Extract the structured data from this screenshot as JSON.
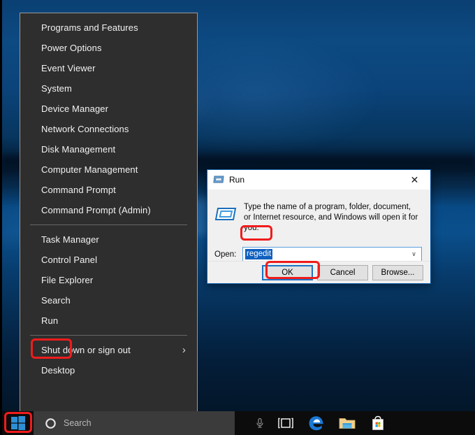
{
  "desktop": {
    "wallpaper_name": "windows-10-hero-blue",
    "colors": {
      "top_blue": "#0d4a82",
      "mid_dark": "#04192f",
      "bottom_navy": "#031628"
    }
  },
  "winx_menu": {
    "name": "Win+X power user menu",
    "groups": [
      {
        "items": [
          {
            "label": "Programs and Features",
            "has_submenu": false
          },
          {
            "label": "Power Options",
            "has_submenu": false
          },
          {
            "label": "Event Viewer",
            "has_submenu": false
          },
          {
            "label": "System",
            "has_submenu": false
          },
          {
            "label": "Device Manager",
            "has_submenu": false
          },
          {
            "label": "Network Connections",
            "has_submenu": false
          },
          {
            "label": "Disk Management",
            "has_submenu": false
          },
          {
            "label": "Computer Management",
            "has_submenu": false
          },
          {
            "label": "Command Prompt",
            "has_submenu": false
          },
          {
            "label": "Command Prompt (Admin)",
            "has_submenu": false
          }
        ]
      },
      {
        "items": [
          {
            "label": "Task Manager",
            "has_submenu": false
          },
          {
            "label": "Control Panel",
            "has_submenu": false
          },
          {
            "label": "File Explorer",
            "has_submenu": false
          },
          {
            "label": "Search",
            "has_submenu": false
          },
          {
            "label": "Run",
            "has_submenu": false,
            "highlighted": true
          }
        ]
      },
      {
        "items": [
          {
            "label": "Shut down or sign out",
            "has_submenu": true,
            "submenu_glyph": "›"
          },
          {
            "label": "Desktop",
            "has_submenu": false
          }
        ]
      }
    ]
  },
  "run_dialog": {
    "title": "Run",
    "title_icon": "run-window-icon",
    "close_glyph": "✕",
    "description": "Type the name of a program, folder, document, or Internet resource, and Windows will open it for you.",
    "open_label": "Open:",
    "open_value": "regedit",
    "open_value_selected": true,
    "dropdown_glyph": "∨",
    "buttons": [
      {
        "label": "OK",
        "focused": true,
        "highlighted": true
      },
      {
        "label": "Cancel",
        "focused": false,
        "highlighted": false
      },
      {
        "label": "Browse...",
        "focused": false,
        "highlighted": false
      }
    ]
  },
  "taskbar": {
    "start_button": {
      "name": "windows-start-button",
      "highlighted": true
    },
    "search": {
      "placeholder": "Search",
      "icon": "cortana-circle-icon"
    },
    "microphone_icon": "microphone-icon",
    "pinned": [
      {
        "name": "task-view-icon",
        "label": "Task View"
      },
      {
        "name": "microsoft-edge-icon",
        "label": "Microsoft Edge"
      },
      {
        "name": "file-explorer-icon",
        "label": "File Explorer"
      },
      {
        "name": "microsoft-store-icon",
        "label": "Microsoft Store"
      }
    ]
  },
  "annotations": {
    "accent_color": "#f01c1c",
    "boxes": [
      {
        "target": "Run menu item"
      },
      {
        "target": "regedit input value"
      },
      {
        "target": "OK button"
      },
      {
        "target": "Start button"
      }
    ]
  }
}
